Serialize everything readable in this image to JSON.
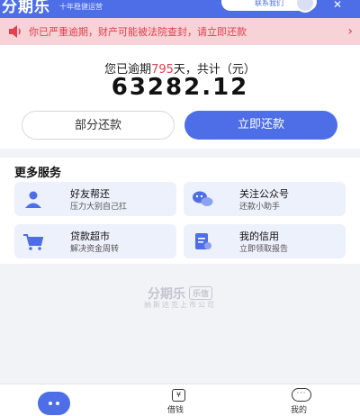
{
  "header": {
    "brand": "分期乐",
    "slogan": "十年稳健运营",
    "contact_label": "联系我们",
    "close_glyph": "✕"
  },
  "notice": {
    "text": "你已严重逾期，财产可能被法院查封，请立即还款",
    "chevron": "›",
    "color": "#e04050"
  },
  "summary": {
    "overdue_prefix": "您已逾期",
    "overdue_days": "795",
    "overdue_suffix": "天，共计（元）",
    "amount": "63282.12",
    "partial_button": "部分还款",
    "repay_button": "立即还款"
  },
  "services": {
    "title": "更多服务",
    "items": [
      {
        "title": "好友帮还",
        "subtitle": "压力大别自己扛",
        "icon": "user-icon"
      },
      {
        "title": "关注公众号",
        "subtitle": "还款小助手",
        "icon": "chat-icon"
      },
      {
        "title": "贷款超市",
        "subtitle": "解决资金周转",
        "icon": "cart-icon"
      },
      {
        "title": "我的信用",
        "subtitle": "立即领取报告",
        "icon": "credit-report-icon"
      }
    ]
  },
  "watermark": {
    "logo": "分期乐",
    "badge": "乐信",
    "subtitle": "纳斯达克上市公司"
  },
  "tabbar": {
    "borrow_glyph": "¥",
    "borrow_label": "借钱",
    "mine_glyph": "···",
    "mine_label": "我的"
  },
  "colors": {
    "accent": "#4d6ee6",
    "warning_bg": "#f7d2d6",
    "warning_text": "#e04050"
  }
}
